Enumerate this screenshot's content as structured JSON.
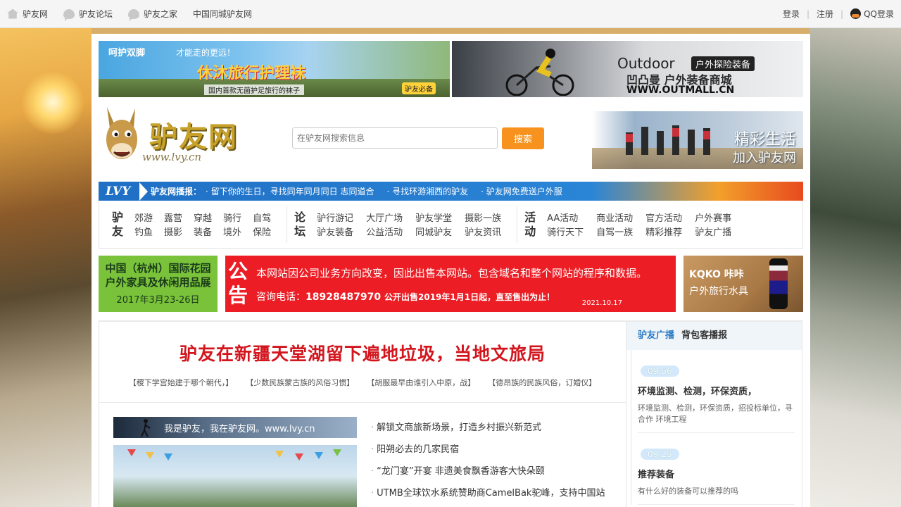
{
  "topbar": {
    "links": [
      "驴友网",
      "驴友论坛",
      "驴友之家",
      "中国同城驴友网"
    ],
    "login": "登录",
    "register": "注册",
    "qq_login": "QQ登录"
  },
  "banners": {
    "socks": {
      "slogan": "呵护双脚",
      "tagline": "才能走的更远！",
      "title": "休沐旅行护理袜",
      "sub": "国内首款无菌护足旅行的袜子",
      "badge": "驴友必备"
    },
    "outdoor": {
      "brand": "Outdoor",
      "brand_tag": "户外探险装备",
      "name": "凹凸曼 户外装备商城",
      "url": "WWW.OUTMALL.CN"
    }
  },
  "header": {
    "logo_text": "驴友网",
    "logo_url": "www.lvy.cn",
    "search_placeholder": "在驴友网搜索信息",
    "search_button": "搜索",
    "photo_line1": "精彩生活",
    "photo_line2": "加入驴友网"
  },
  "broadcast": {
    "brand": "LVY",
    "label": "驴友网播报：",
    "items": [
      "留下你的生日，寻找同年同月同日 志同道合",
      "寻找环游湘西的驴友",
      "驴友网免费送户外服"
    ]
  },
  "catnav": {
    "groups": [
      {
        "title": "驴友",
        "items": [
          "郊游",
          "钓鱼",
          "露营",
          "摄影",
          "穿越",
          "装备",
          "骑行",
          "境外",
          "自驾",
          "保险"
        ]
      },
      {
        "title": "论坛",
        "items": [
          "驴行游记",
          "驴友装备",
          "大厅广场",
          "公益活动",
          "驴友学堂",
          "同城驴友",
          "摄影一族",
          "驴友资讯"
        ]
      },
      {
        "title": "活动",
        "items": [
          "AA活动",
          "骑行天下",
          "商业活动",
          "自驾一族",
          "官方活动",
          "精彩推荐",
          "户外赛事",
          "驴友广播"
        ]
      }
    ]
  },
  "ads": {
    "expo": {
      "line1": "中国（杭州）国际花园",
      "line2": "户外家具及休闲用品展",
      "date": "2017年3月23-26日"
    },
    "notice": {
      "label": "公告",
      "line1": "本网站因公司业务方向改变，因此出售本网站。包含域名和整个网站的程序和数据。",
      "phone_label": "咨询电话：",
      "phone": "18928487970",
      "sale": "公开出售2019年1月1日起，直至售出为止！",
      "date": "2021.10.17"
    },
    "bottle": {
      "brand": "KQKO 咔咔",
      "sub": "户外旅行水具"
    }
  },
  "main": {
    "headline": "驴友在新疆天堂湖留下遍地垃圾，当地文旅局",
    "related": [
      "【稷下学宫始建于哪个朝代，】",
      "【少数民族蒙古族的风俗习惯】",
      "【胡服最早由谁引入中原，战】",
      "【德昂族的民族风俗，订婚仪】"
    ],
    "photo_banner": "我是驴友，我在驴友网。www.lvy.cn",
    "news": [
      "解锁文商旅新场景，打造乡村振兴新范式",
      "阳朔必去的几家民宿",
      "“龙门宴”开宴 非遗美食飘香游客大快朵颐",
      "UTMB全球饮水系统赞助商CamelBak驼峰，支持中国站"
    ]
  },
  "sidebar": {
    "tab1": "驴友广播",
    "tab2": "背包客播报",
    "feed": [
      {
        "time": "09:56",
        "title": "环境监测、检测，环保资质，",
        "desc": "环境监测、检测，环保资质，招投标单位，寻合作 环境工程"
      },
      {
        "time": "09:25",
        "title": "推荐装备",
        "desc": "有什么好的装备可以推荐的吗"
      }
    ]
  }
}
